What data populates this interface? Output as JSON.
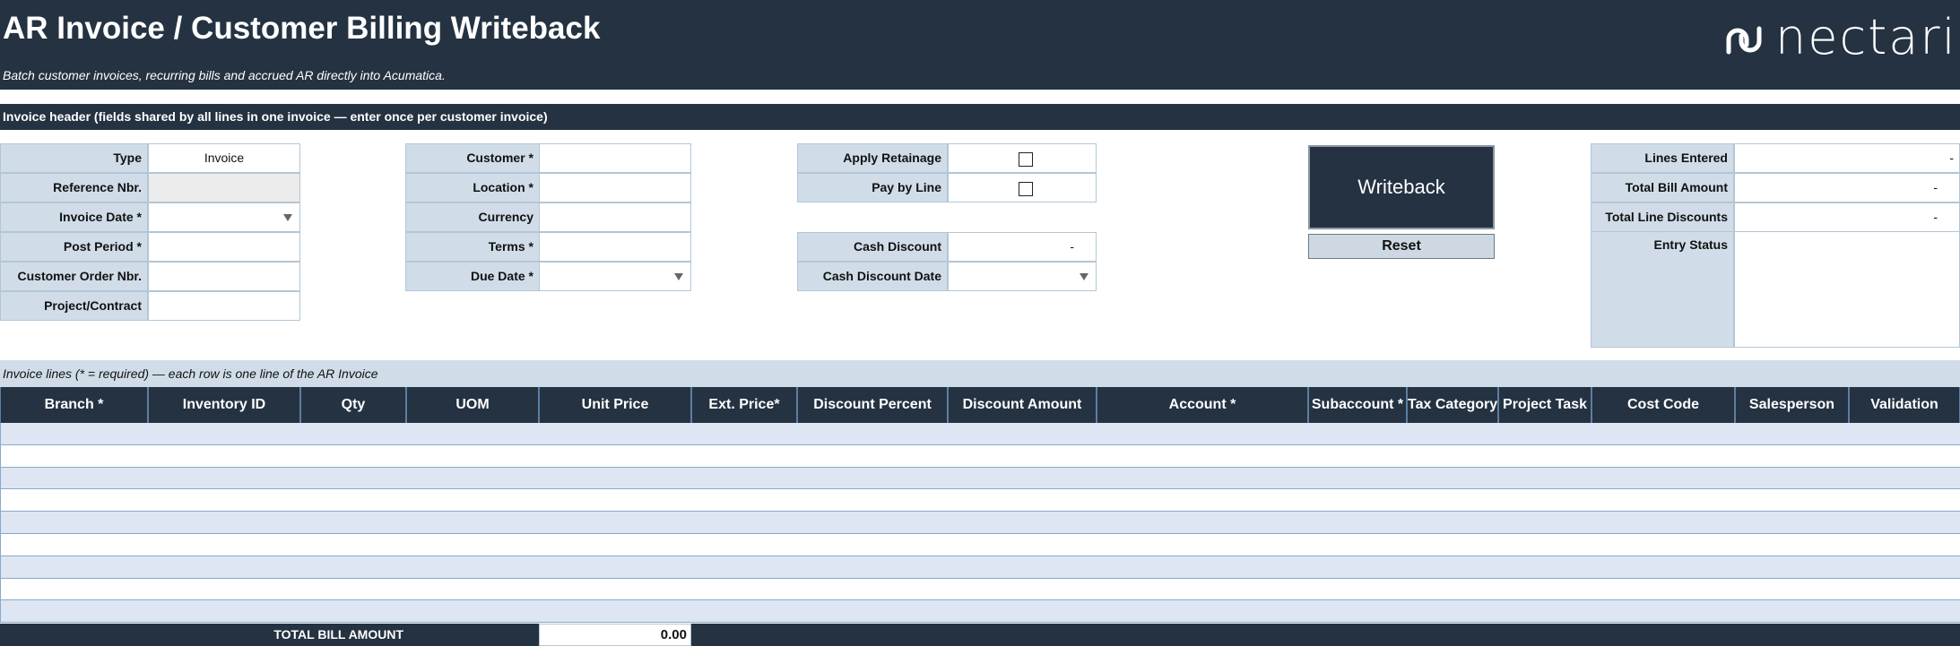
{
  "header": {
    "title": "AR Invoice / Customer Billing Writeback",
    "subtitle": "Batch customer invoices, recurring bills and accrued AR directly into Acumatica.",
    "logo_text": "nectari"
  },
  "invoice_header": {
    "section_title": "Invoice header  (fields shared by all lines in one invoice — enter once per customer invoice)",
    "type_label": "Type",
    "type_value": "Invoice",
    "reference_label": "Reference Nbr.",
    "invoice_date_label": "Invoice Date *",
    "post_period_label": "Post Period *",
    "customer_order_label": "Customer Order Nbr.",
    "project_contract_label": "Project/Contract",
    "customer_label": "Customer *",
    "location_label": "Location *",
    "currency_label": "Currency",
    "terms_label": "Terms *",
    "due_date_label": "Due Date *",
    "apply_retainage_label": "Apply Retainage",
    "pay_by_line_label": "Pay by Line",
    "cash_discount_label": "Cash Discount",
    "cash_discount_value": "-",
    "cash_discount_date_label": "Cash Discount Date"
  },
  "actions": {
    "writeback_label": "Writeback",
    "reset_label": "Reset"
  },
  "summary": {
    "lines_entered_label": "Lines Entered",
    "lines_entered_value": "-",
    "total_bill_label": "Total Bill Amount",
    "total_bill_value": "-",
    "total_discounts_label": "Total Line Discounts",
    "total_discounts_value": "-",
    "entry_status_label": "Entry Status"
  },
  "lines": {
    "caption": "Invoice lines  (* = required) — each row is one line of the AR Invoice",
    "columns": [
      "Branch *",
      "Inventory ID",
      "Qty",
      "UOM",
      "Unit Price",
      "Ext. Price*",
      "Discount Percent",
      "Discount Amount",
      "Account *",
      "Subaccount *",
      "Tax Category",
      "Project Task",
      "Cost Code",
      "Salesperson",
      "Validation"
    ],
    "total_label": "TOTAL BILL AMOUNT",
    "total_value": "0.00"
  },
  "colors": {
    "banner": "#243242",
    "label_fill": "#d0dde8",
    "row_alt": "#dde6f2"
  }
}
